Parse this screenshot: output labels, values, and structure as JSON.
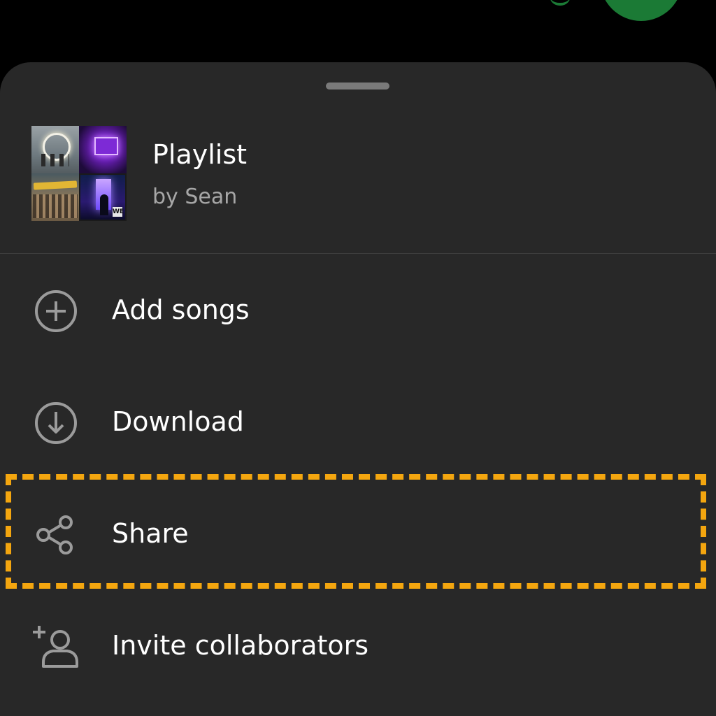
{
  "header": {
    "title": "Playlist",
    "subtitle": "by Sean"
  },
  "menu": {
    "items": [
      {
        "label": "Add songs",
        "icon": "plus-circle-icon"
      },
      {
        "label": "Download",
        "icon": "download-circle-icon"
      },
      {
        "label": "Share",
        "icon": "share-icon"
      },
      {
        "label": "Invite collaborators",
        "icon": "add-person-icon"
      }
    ]
  },
  "cover": {
    "badge_text": "WE"
  },
  "colors": {
    "sheet_background": "#282828",
    "screen_background": "#000000",
    "icon_gray": "#9b9b9b",
    "text_primary": "#ffffff",
    "text_secondary": "#a7a7a7",
    "highlight": "#f4a60f",
    "accent_green": "#1b7a35"
  }
}
